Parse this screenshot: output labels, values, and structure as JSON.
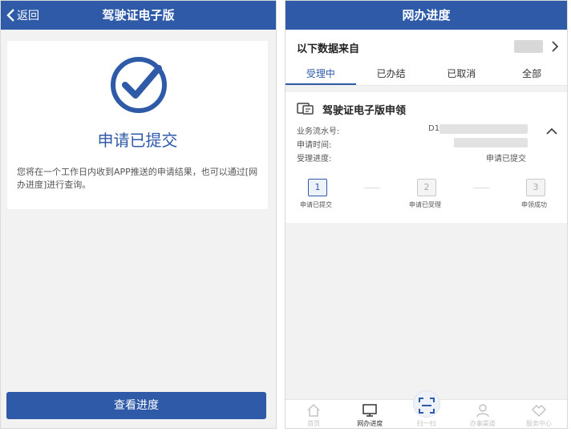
{
  "left": {
    "header": {
      "back_label": "返回",
      "title": "驾驶证电子版"
    },
    "result": {
      "title": "申请已提交",
      "description": "您将在一个工作日内收到APP推送的申请结果，也可以通过[网办进度]进行查询。"
    },
    "action_button": "查看进度"
  },
  "right": {
    "header": {
      "title": "网办进度"
    },
    "source_label": "以下数据来自",
    "tabs": [
      "受理中",
      "已办结",
      "已取消",
      "全部"
    ],
    "active_tab": "受理中",
    "application": {
      "title": "驾驶证电子版申领",
      "serial_label": "业务流水号:",
      "serial_value_visible": "D1",
      "time_label": "申请时间:",
      "progress_label": "受理进度:",
      "progress_value": "申请已提交"
    },
    "steps": [
      {
        "number": "1",
        "label": "申请已提交",
        "active": true
      },
      {
        "number": "2",
        "label": "申请已受理",
        "active": false
      },
      {
        "number": "3",
        "label": "申领成功",
        "active": false
      }
    ],
    "bottom_nav": [
      {
        "label": "首页",
        "icon": "home-icon",
        "active": false
      },
      {
        "label": "网办进度",
        "icon": "monitor-icon",
        "active": true
      },
      {
        "label": "扫一扫",
        "icon": "scan-icon",
        "active": false
      },
      {
        "label": "办事渠道",
        "icon": "user-icon",
        "active": false
      },
      {
        "label": "服务中心",
        "icon": "handshake-icon",
        "active": false
      }
    ]
  },
  "colors": {
    "primary": "#2e5aa8",
    "background": "#f2f2f2"
  }
}
